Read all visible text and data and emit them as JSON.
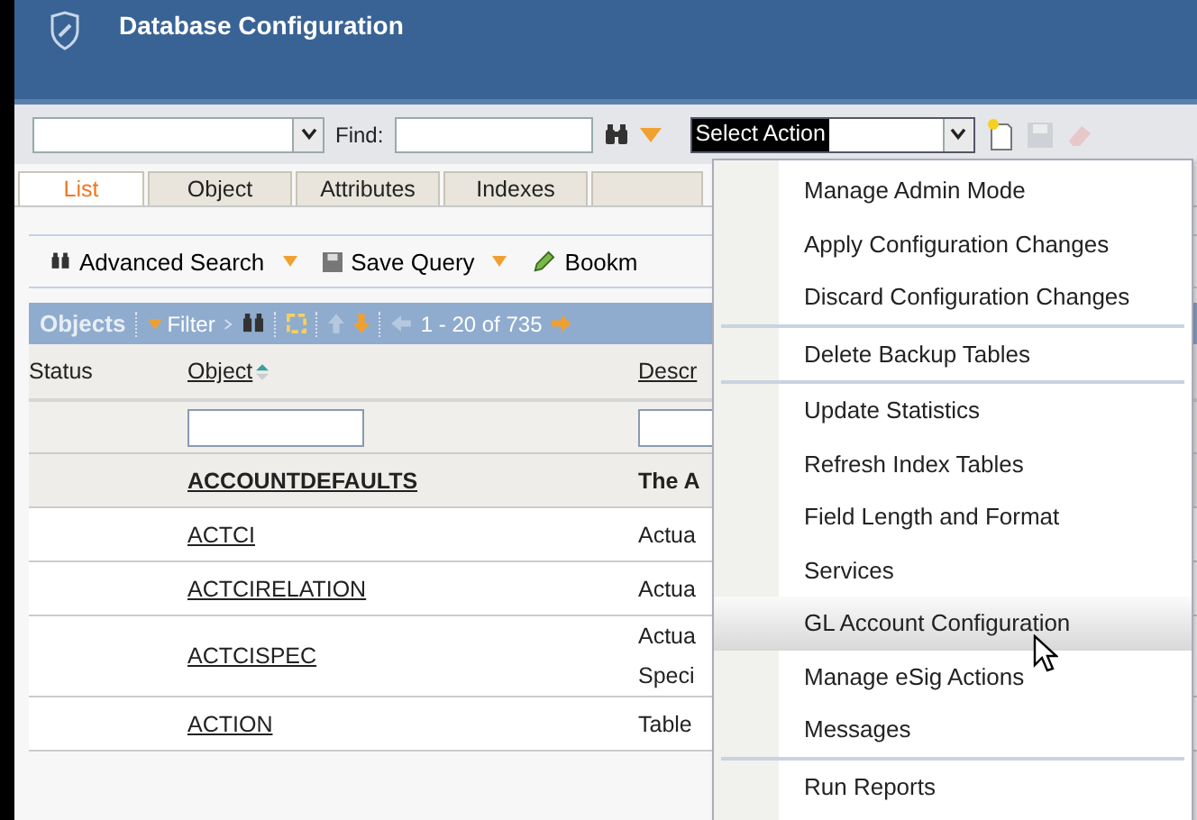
{
  "window": {
    "title": "Database Configuration"
  },
  "toolbar": {
    "find_label": "Find:",
    "action_select": {
      "value": "Select Action",
      "highlighted": true
    }
  },
  "tabs": [
    {
      "label": "List",
      "selected": true
    },
    {
      "label": "Object",
      "selected": false
    },
    {
      "label": "Attributes",
      "selected": false
    },
    {
      "label": "Indexes",
      "selected": false
    }
  ],
  "query_toolbar": [
    {
      "label": "Advanced Search",
      "dropdown": true
    },
    {
      "label": "Save Query",
      "dropdown": true
    },
    {
      "label": "Bookm",
      "dropdown": false
    }
  ],
  "list_bar": {
    "title": "Objects",
    "filter": "Filter",
    "paging": "1 - 20 of 735"
  },
  "table": {
    "columns": [
      "Status",
      "Object",
      "Descr"
    ],
    "rows": [
      {
        "object": "ACCOUNTDEFAULTS",
        "description": [
          "The A"
        ],
        "selected": true
      },
      {
        "object": "ACTCI",
        "description": [
          "Actua"
        ],
        "selected": false
      },
      {
        "object": "ACTCIRELATION",
        "description": [
          "Actua"
        ],
        "selected": false
      },
      {
        "object": "ACTCISPEC",
        "description": [
          "Actua",
          "Speci"
        ],
        "selected": false
      },
      {
        "object": "ACTION",
        "description": [
          "Table"
        ],
        "selected": false
      }
    ]
  },
  "action_menu": [
    {
      "label": "Manage Admin Mode",
      "divider_above": false,
      "selected": false
    },
    {
      "label": "Apply Configuration Changes",
      "divider_above": false,
      "selected": false
    },
    {
      "label": "Discard Configuration Changes",
      "divider_above": false,
      "selected": false
    },
    {
      "label": "Delete Backup Tables",
      "divider_above": true,
      "selected": false
    },
    {
      "label": "Update Statistics",
      "divider_above": true,
      "selected": false
    },
    {
      "label": "Refresh Index Tables",
      "divider_above": false,
      "selected": false
    },
    {
      "label": "Field Length and Format",
      "divider_above": false,
      "selected": false
    },
    {
      "label": "Services",
      "divider_above": false,
      "selected": false
    },
    {
      "label": "GL Account Configuration",
      "divider_above": false,
      "selected": true
    },
    {
      "label": "Manage eSig Actions",
      "divider_above": false,
      "selected": false
    },
    {
      "label": "Messages",
      "divider_above": false,
      "selected": false
    },
    {
      "label": "Run Reports",
      "divider_above": true,
      "selected": false
    }
  ]
}
